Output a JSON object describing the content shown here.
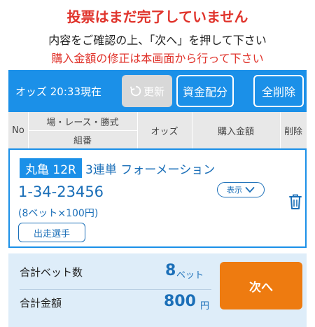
{
  "messages": {
    "not_complete": "投票はまだ完了していません",
    "confirm": "内容をご確認の上、「次へ」を押して下さい",
    "modify_note": "購入金額の修正は本画面から行って下さい"
  },
  "odds_bar": {
    "label": "オッズ 20:33現在",
    "refresh_label": "更新",
    "allocate_label": "資金配分",
    "clear_all_label": "全削除"
  },
  "table_header": {
    "no": "No",
    "venue_race_type": "場・レース・勝式",
    "combo": "組番",
    "odds": "オッズ",
    "amount": "購入金額",
    "delete": "削除"
  },
  "bet": {
    "venue_race": "丸亀 12R",
    "bet_type": "3連単 フォーメーション",
    "combination": "1-34-23456",
    "detail": "(8ベット×100円)",
    "show_label": "表示",
    "runners_label": "出走選手"
  },
  "summary": {
    "bet_count_label": "合計ベット数",
    "bet_count_value": "8",
    "bet_count_unit": "ベット",
    "total_label": "合計金額",
    "total_value": "800",
    "total_unit": "円",
    "next_label": "次へ"
  },
  "colors": {
    "accent_blue": "#1b90e8",
    "alert_red": "#e0332b",
    "next_orange": "#ee7b10",
    "summary_bg": "#deedf9"
  }
}
